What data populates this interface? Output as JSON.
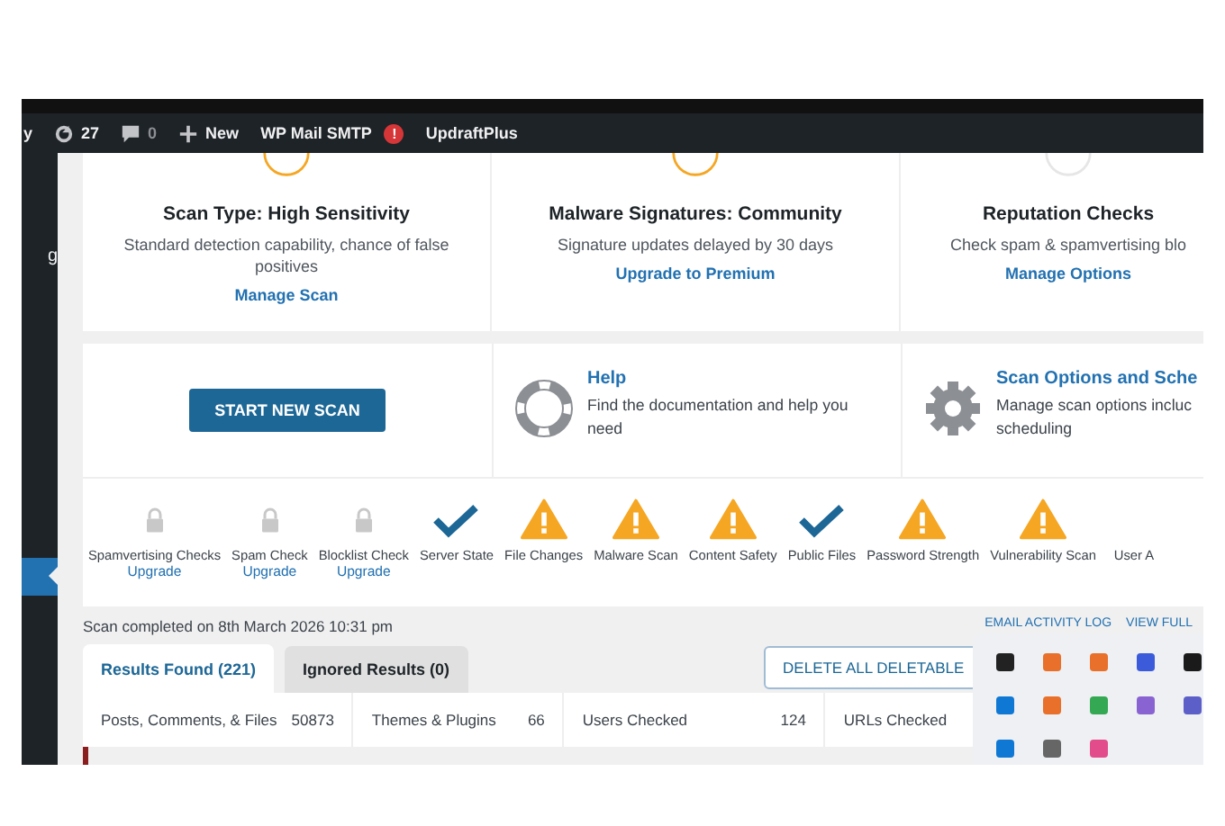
{
  "admin_bar": {
    "items": [
      {
        "kind": "cut",
        "label": "y"
      },
      {
        "kind": "updates",
        "label": "27"
      },
      {
        "kind": "comments",
        "label": "0"
      },
      {
        "kind": "new",
        "label": "New"
      },
      {
        "kind": "alert",
        "label": "WP Mail SMTP",
        "badge": "!"
      },
      {
        "kind": "plain",
        "label": "UpdraftPlus"
      }
    ]
  },
  "sidebar": {
    "items": [
      {
        "label": "g",
        "selected": false
      },
      {
        "selected": true
      }
    ]
  },
  "summary_cards": [
    {
      "title": "Scan Type: High Sensitivity",
      "description": "Standard detection capability, chance of false positives",
      "link": "Manage Scan",
      "color": "#f5a623"
    },
    {
      "title": "Malware Signatures: Community",
      "description": "Signature updates delayed by 30 days",
      "link": "Upgrade to Premium",
      "color": "#f5a623"
    },
    {
      "title": "Reputation Checks",
      "description": "Check spam & spamvertising blo",
      "link": "Manage Options",
      "color": "#e6e6e6"
    }
  ],
  "start_button": "START NEW SCAN",
  "info_cards": [
    {
      "kind": "help",
      "title": "Help",
      "description": "Find the documentation and help you need"
    },
    {
      "kind": "options",
      "title": "Scan Options and Sche",
      "description": "Manage scan options incluc scheduling"
    }
  ],
  "steps": [
    {
      "label": "Spamvertising Checks",
      "kind": "locked",
      "link": "Upgrade"
    },
    {
      "label": "Spam Check",
      "kind": "locked",
      "link": "Upgrade"
    },
    {
      "label": "Blocklist Check",
      "kind": "locked",
      "link": "Upgrade"
    },
    {
      "label": "Server State",
      "kind": "passed"
    },
    {
      "label": "File Changes",
      "kind": "warning"
    },
    {
      "label": "Malware Scan",
      "kind": "warning"
    },
    {
      "label": "Content Safety",
      "kind": "warning"
    },
    {
      "label": "Public Files",
      "kind": "passed"
    },
    {
      "label": "Password Strength",
      "kind": "warning"
    },
    {
      "label": "Vulnerability Scan",
      "kind": "warning"
    },
    {
      "label": "User A",
      "kind": "none"
    }
  ],
  "scan_completed": "Scan completed on 8th March 2026 10:31 pm",
  "log_links": [
    "EMAIL ACTIVITY LOG",
    "VIEW FULL"
  ],
  "tabs": [
    {
      "label": "Results Found (221)",
      "selected": true
    },
    {
      "label": "Ignored Results (0)",
      "selected": false
    }
  ],
  "delete_button": "DELETE ALL DELETABLE",
  "stats": [
    {
      "label": "Posts, Comments, & Files",
      "value": "50873"
    },
    {
      "label": "Themes & Plugins",
      "value": "66"
    },
    {
      "label": "Users Checked",
      "value": "124"
    },
    {
      "label": "URLs Checked"
    }
  ]
}
